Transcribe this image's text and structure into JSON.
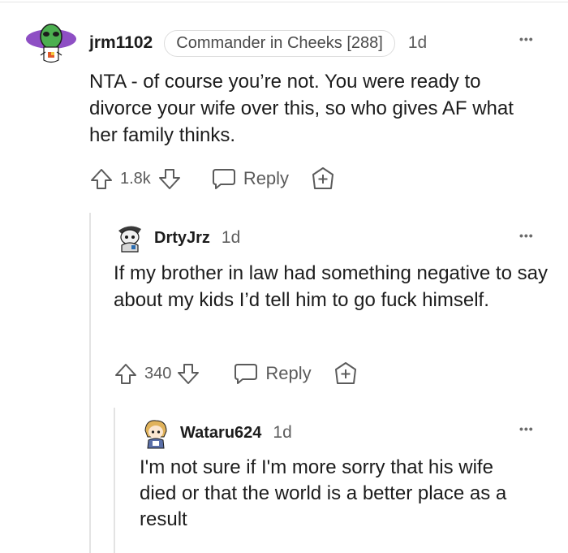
{
  "comments": [
    {
      "username": "jrm1102",
      "flair": "Commander in Cheeks [288]",
      "age": "1d",
      "body": "NTA - of course you’re not. You were ready to divorce your wife over this, so who gives AF what her family thinks.",
      "score": "1.8k",
      "reply_label": "Reply",
      "more_label": "•••"
    },
    {
      "username": "DrtyJrz",
      "age": "1d",
      "body": "If my brother in law had something negative to say about my kids I’d tell him to go fuck himself.",
      "score": "340",
      "reply_label": "Reply",
      "more_label": "•••"
    },
    {
      "username": "Wataru624",
      "age": "1d",
      "body": "I'm not sure if I'm more sorry that his wife died or that the world is a better place as a result",
      "more_label": "•••"
    }
  ],
  "colors": {
    "avatar1_bg": "#8e4fc4",
    "avatar1_head": "#4caf50",
    "icon_gray": "#5b5b5b",
    "thread_line": "#e3e3e3"
  }
}
